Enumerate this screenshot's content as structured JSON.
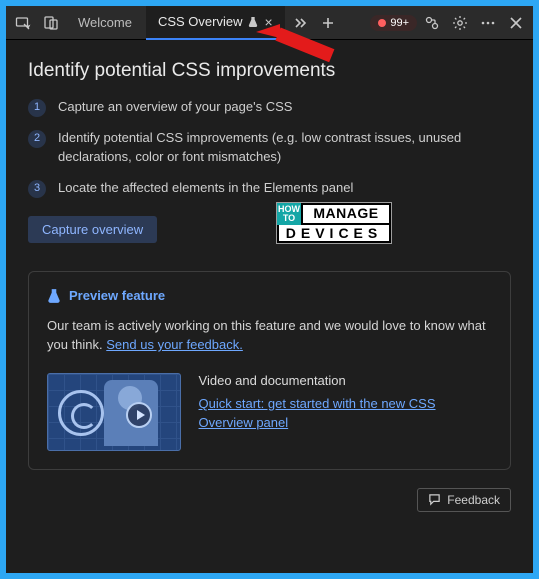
{
  "tabs": {
    "welcome": "Welcome",
    "css_overview": "CSS Overview"
  },
  "errors_count": "99+",
  "page": {
    "title": "Identify potential CSS improvements",
    "steps": [
      "Capture an overview of your page's CSS",
      "Identify potential CSS improvements (e.g. low contrast issues, unused declarations, color or font mismatches)",
      "Locate the affected elements in the Elements panel"
    ],
    "capture_button": "Capture overview"
  },
  "preview": {
    "heading": "Preview feature",
    "body_prefix": "Our team is actively working on this feature and we would love to know what you think. ",
    "feedback_link": "Send us your feedback.",
    "video_heading": "Video and documentation",
    "quickstart_link": "Quick start: get started with the new CSS Overview panel"
  },
  "footer": {
    "feedback_button": "Feedback"
  },
  "watermark": {
    "how": "HOW",
    "to": "TO",
    "manage": "MANAGE",
    "devices": "DEVICES"
  }
}
